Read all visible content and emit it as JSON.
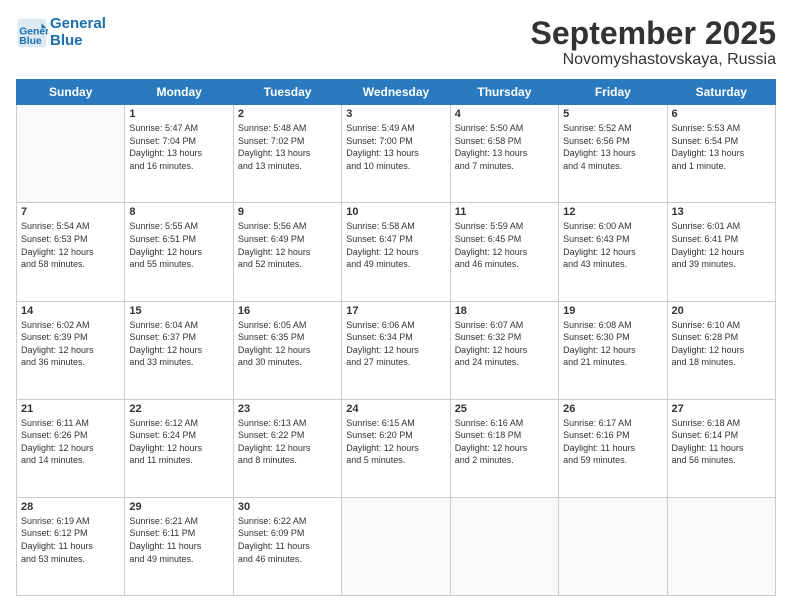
{
  "header": {
    "logo_line1": "General",
    "logo_line2": "Blue",
    "month": "September 2025",
    "location": "Novomyshastovskaya, Russia"
  },
  "weekdays": [
    "Sunday",
    "Monday",
    "Tuesday",
    "Wednesday",
    "Thursday",
    "Friday",
    "Saturday"
  ],
  "weeks": [
    [
      {
        "day": "",
        "info": ""
      },
      {
        "day": "1",
        "info": "Sunrise: 5:47 AM\nSunset: 7:04 PM\nDaylight: 13 hours\nand 16 minutes."
      },
      {
        "day": "2",
        "info": "Sunrise: 5:48 AM\nSunset: 7:02 PM\nDaylight: 13 hours\nand 13 minutes."
      },
      {
        "day": "3",
        "info": "Sunrise: 5:49 AM\nSunset: 7:00 PM\nDaylight: 13 hours\nand 10 minutes."
      },
      {
        "day": "4",
        "info": "Sunrise: 5:50 AM\nSunset: 6:58 PM\nDaylight: 13 hours\nand 7 minutes."
      },
      {
        "day": "5",
        "info": "Sunrise: 5:52 AM\nSunset: 6:56 PM\nDaylight: 13 hours\nand 4 minutes."
      },
      {
        "day": "6",
        "info": "Sunrise: 5:53 AM\nSunset: 6:54 PM\nDaylight: 13 hours\nand 1 minute."
      }
    ],
    [
      {
        "day": "7",
        "info": "Sunrise: 5:54 AM\nSunset: 6:53 PM\nDaylight: 12 hours\nand 58 minutes."
      },
      {
        "day": "8",
        "info": "Sunrise: 5:55 AM\nSunset: 6:51 PM\nDaylight: 12 hours\nand 55 minutes."
      },
      {
        "day": "9",
        "info": "Sunrise: 5:56 AM\nSunset: 6:49 PM\nDaylight: 12 hours\nand 52 minutes."
      },
      {
        "day": "10",
        "info": "Sunrise: 5:58 AM\nSunset: 6:47 PM\nDaylight: 12 hours\nand 49 minutes."
      },
      {
        "day": "11",
        "info": "Sunrise: 5:59 AM\nSunset: 6:45 PM\nDaylight: 12 hours\nand 46 minutes."
      },
      {
        "day": "12",
        "info": "Sunrise: 6:00 AM\nSunset: 6:43 PM\nDaylight: 12 hours\nand 43 minutes."
      },
      {
        "day": "13",
        "info": "Sunrise: 6:01 AM\nSunset: 6:41 PM\nDaylight: 12 hours\nand 39 minutes."
      }
    ],
    [
      {
        "day": "14",
        "info": "Sunrise: 6:02 AM\nSunset: 6:39 PM\nDaylight: 12 hours\nand 36 minutes."
      },
      {
        "day": "15",
        "info": "Sunrise: 6:04 AM\nSunset: 6:37 PM\nDaylight: 12 hours\nand 33 minutes."
      },
      {
        "day": "16",
        "info": "Sunrise: 6:05 AM\nSunset: 6:35 PM\nDaylight: 12 hours\nand 30 minutes."
      },
      {
        "day": "17",
        "info": "Sunrise: 6:06 AM\nSunset: 6:34 PM\nDaylight: 12 hours\nand 27 minutes."
      },
      {
        "day": "18",
        "info": "Sunrise: 6:07 AM\nSunset: 6:32 PM\nDaylight: 12 hours\nand 24 minutes."
      },
      {
        "day": "19",
        "info": "Sunrise: 6:08 AM\nSunset: 6:30 PM\nDaylight: 12 hours\nand 21 minutes."
      },
      {
        "day": "20",
        "info": "Sunrise: 6:10 AM\nSunset: 6:28 PM\nDaylight: 12 hours\nand 18 minutes."
      }
    ],
    [
      {
        "day": "21",
        "info": "Sunrise: 6:11 AM\nSunset: 6:26 PM\nDaylight: 12 hours\nand 14 minutes."
      },
      {
        "day": "22",
        "info": "Sunrise: 6:12 AM\nSunset: 6:24 PM\nDaylight: 12 hours\nand 11 minutes."
      },
      {
        "day": "23",
        "info": "Sunrise: 6:13 AM\nSunset: 6:22 PM\nDaylight: 12 hours\nand 8 minutes."
      },
      {
        "day": "24",
        "info": "Sunrise: 6:15 AM\nSunset: 6:20 PM\nDaylight: 12 hours\nand 5 minutes."
      },
      {
        "day": "25",
        "info": "Sunrise: 6:16 AM\nSunset: 6:18 PM\nDaylight: 12 hours\nand 2 minutes."
      },
      {
        "day": "26",
        "info": "Sunrise: 6:17 AM\nSunset: 6:16 PM\nDaylight: 11 hours\nand 59 minutes."
      },
      {
        "day": "27",
        "info": "Sunrise: 6:18 AM\nSunset: 6:14 PM\nDaylight: 11 hours\nand 56 minutes."
      }
    ],
    [
      {
        "day": "28",
        "info": "Sunrise: 6:19 AM\nSunset: 6:12 PM\nDaylight: 11 hours\nand 53 minutes."
      },
      {
        "day": "29",
        "info": "Sunrise: 6:21 AM\nSunset: 6:11 PM\nDaylight: 11 hours\nand 49 minutes."
      },
      {
        "day": "30",
        "info": "Sunrise: 6:22 AM\nSunset: 6:09 PM\nDaylight: 11 hours\nand 46 minutes."
      },
      {
        "day": "",
        "info": ""
      },
      {
        "day": "",
        "info": ""
      },
      {
        "day": "",
        "info": ""
      },
      {
        "day": "",
        "info": ""
      }
    ]
  ]
}
